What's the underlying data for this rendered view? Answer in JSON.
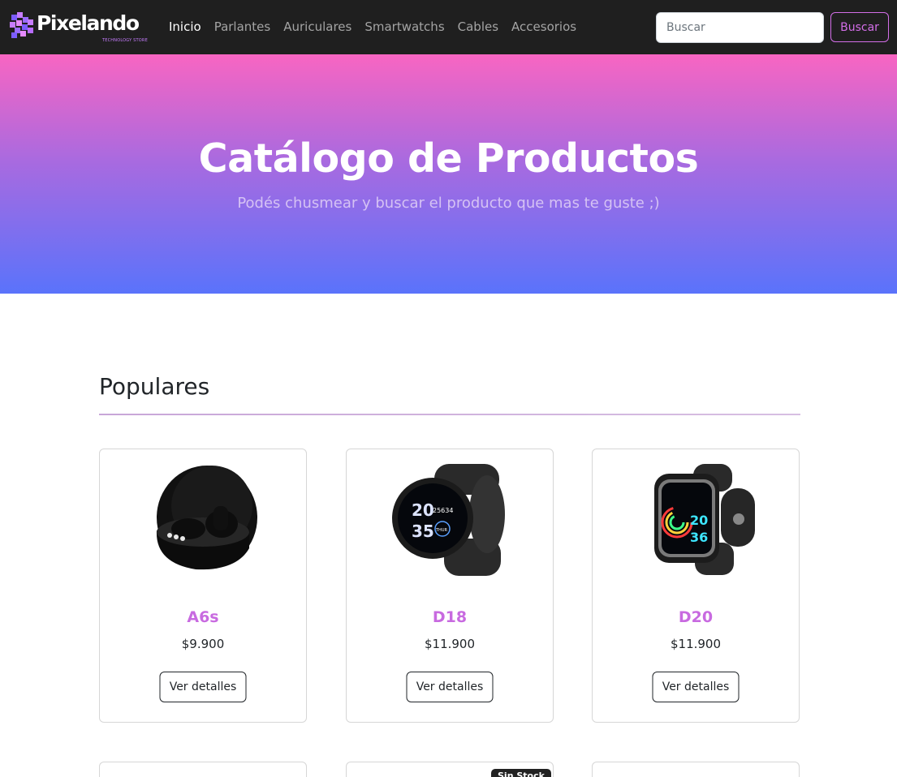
{
  "brand": {
    "name": "Pixelando",
    "tagline": "TECHNOLOGY STORE"
  },
  "nav": {
    "items": [
      {
        "label": "Inicio",
        "active": true
      },
      {
        "label": "Parlantes",
        "active": false
      },
      {
        "label": "Auriculares",
        "active": false
      },
      {
        "label": "Smartwatchs",
        "active": false
      },
      {
        "label": "Cables",
        "active": false
      },
      {
        "label": "Accesorios",
        "active": false
      }
    ],
    "search": {
      "placeholder": "Buscar",
      "value": "",
      "button_label": "Buscar"
    }
  },
  "hero": {
    "title": "Catálogo de Productos",
    "subtitle": "Podés chusmear y buscar el producto que mas te guste ;)"
  },
  "colors": {
    "accent": "#c86ae0",
    "navbar": "#1f1f1f",
    "hero_top": "#f865c2",
    "hero_bottom": "#5a73fb"
  },
  "section": {
    "title": "Populares",
    "products": [
      {
        "name": "A6s",
        "price": "$9.900",
        "button": "Ver detalles",
        "image": "earbuds-image"
      },
      {
        "name": "D18",
        "price": "$11.900",
        "button": "Ver detalles",
        "image": "round-smartwatch-image"
      },
      {
        "name": "D20",
        "price": "$11.900",
        "button": "Ver detalles",
        "image": "square-smartwatch-image"
      }
    ],
    "next_row_badge": "Sin Stock"
  },
  "watch_faces": {
    "d18": {
      "time_h": "20",
      "time_m": "35",
      "steps": "25634",
      "day": "THUR"
    },
    "d20": {
      "time_h": "20",
      "time_m": "36"
    }
  }
}
